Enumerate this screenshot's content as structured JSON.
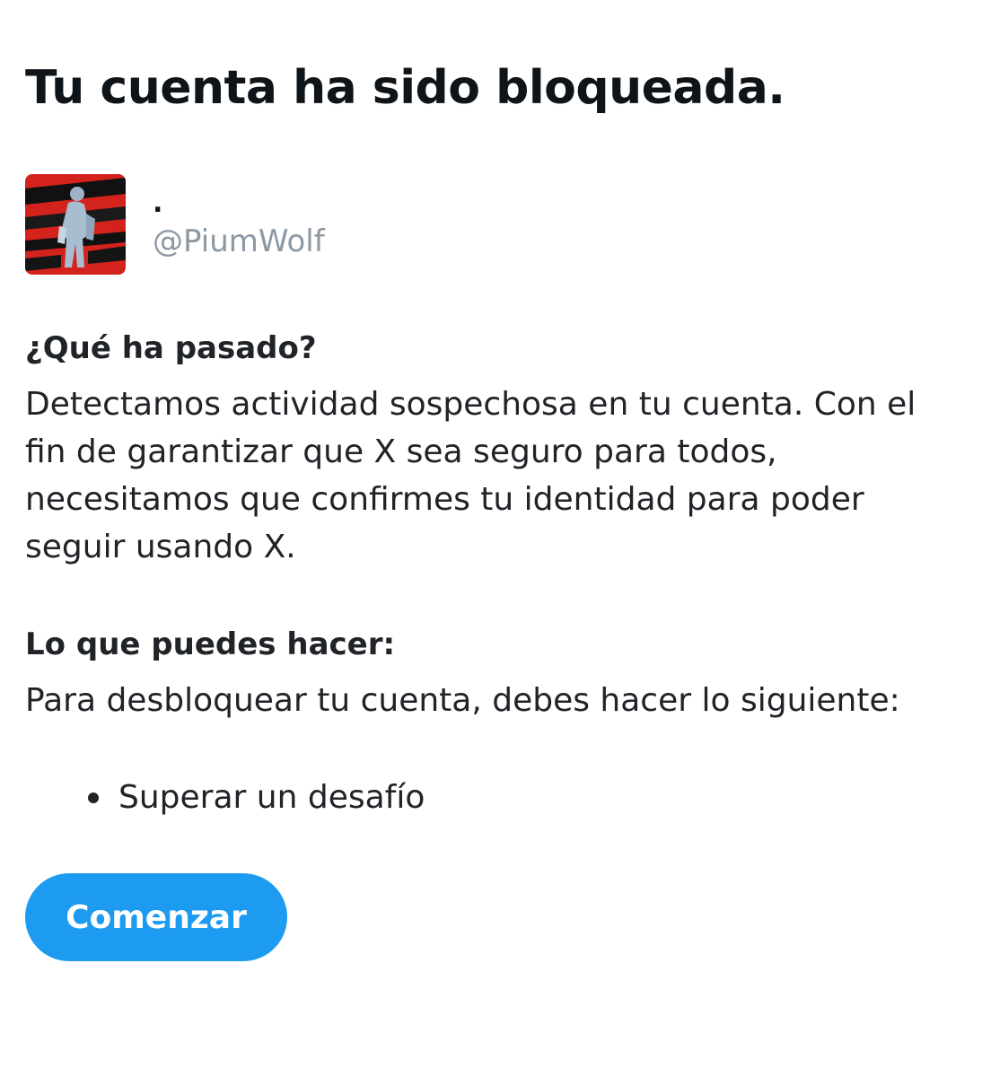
{
  "header": {
    "title": "Tu cuenta ha sido bloqueada."
  },
  "account": {
    "display_name": ".",
    "handle": "@PiumWolf",
    "avatar_icon": "profile-photo-red-black-figure"
  },
  "what_happened": {
    "heading": "¿Qué ha pasado?",
    "body": "Detectamos actividad sospechosa en tu cuenta. Con el fin de garantizar que X sea seguro para todos, necesitamos que confirmes tu identidad para poder seguir usando X."
  },
  "what_you_can_do": {
    "heading": "Lo que puedes hacer:",
    "body": "Para desbloquear tu cuenta, debes hacer lo siguiente:",
    "steps": [
      "Superar un desafío"
    ]
  },
  "actions": {
    "start_label": "Comenzar"
  },
  "colors": {
    "accent": "#1d9bf0",
    "handle": "#8b98a5",
    "text": "#202327"
  }
}
